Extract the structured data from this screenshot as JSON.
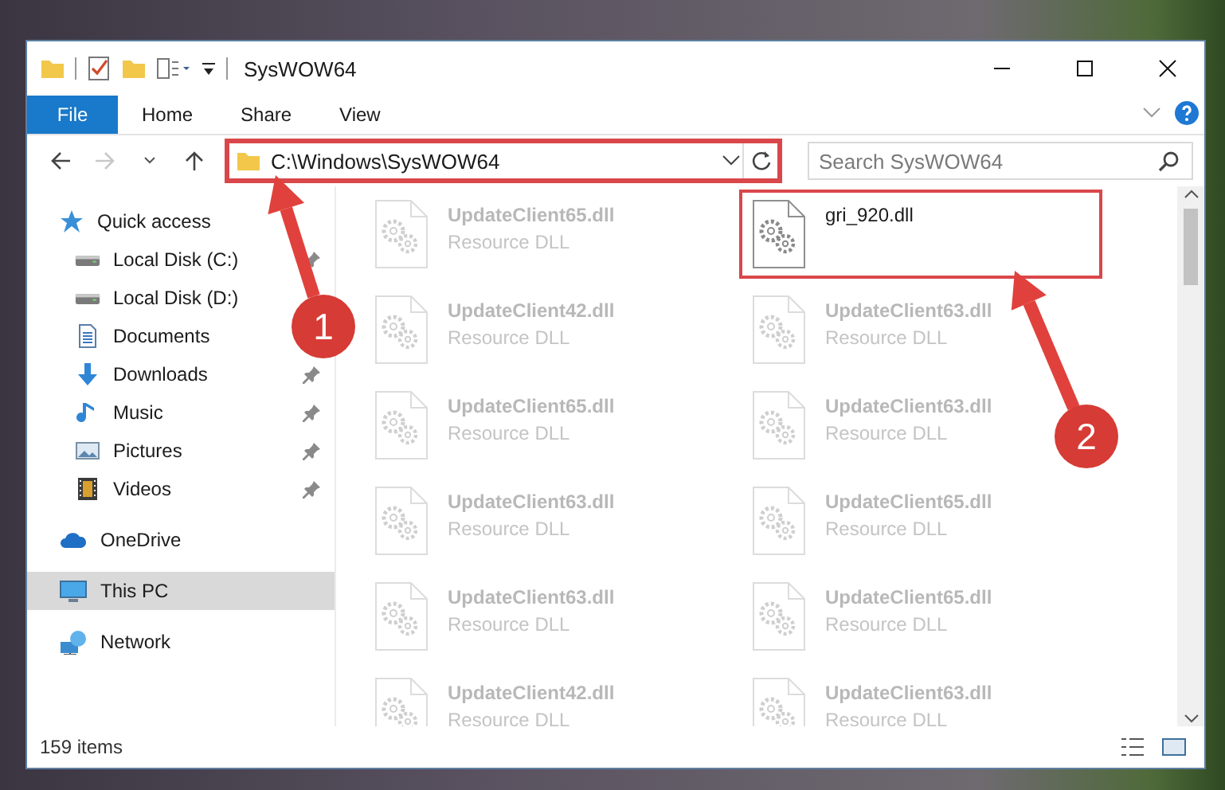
{
  "window": {
    "title": "SysWOW64"
  },
  "ribbon_tabs": [
    {
      "label": "File",
      "kind": "file",
      "selected": false
    },
    {
      "label": "Home",
      "kind": "tab",
      "selected": false
    },
    {
      "label": "Share",
      "kind": "tab",
      "selected": false
    },
    {
      "label": "View",
      "kind": "tab",
      "selected": false
    }
  ],
  "address_bar": {
    "path": "C:\\Windows\\SysWOW64",
    "highlighted": true
  },
  "search": {
    "placeholder": "Search SysWOW64"
  },
  "nav": [
    {
      "label": "Quick access",
      "kind": "star",
      "selected": false,
      "children": [
        {
          "label": "Local Disk (C:)",
          "kind": "drive",
          "pinned": true,
          "selected": false
        },
        {
          "label": "Local Disk (D:)",
          "kind": "drive",
          "pinned": false,
          "selected": false
        },
        {
          "label": "Documents",
          "kind": "documents",
          "pinned": false,
          "selected": false
        },
        {
          "label": "Downloads",
          "kind": "downloads",
          "pinned": true,
          "selected": false
        },
        {
          "label": "Music",
          "kind": "music",
          "pinned": true,
          "selected": false
        },
        {
          "label": "Pictures",
          "kind": "pictures",
          "pinned": true,
          "selected": false
        },
        {
          "label": "Videos",
          "kind": "videos",
          "pinned": true,
          "selected": false
        }
      ]
    },
    {
      "label": "OneDrive",
      "kind": "cloud",
      "selected": false
    },
    {
      "label": "This PC",
      "kind": "pc",
      "selected": true
    },
    {
      "label": "Network",
      "kind": "network",
      "selected": false
    }
  ],
  "files": [
    {
      "name": "UpdateClient65.dll",
      "type": "Resource DLL",
      "blurred": true,
      "highlighted": false
    },
    {
      "name": "gri_920.dll",
      "blurred": false,
      "highlighted": true
    },
    {
      "name": "UpdateClient42.dll",
      "type": "Resource DLL",
      "blurred": true,
      "highlighted": false
    },
    {
      "name": "UpdateClient63.dll",
      "type": "Resource DLL",
      "blurred": true,
      "highlighted": false
    },
    {
      "name": "UpdateClient65.dll",
      "type": "Resource DLL",
      "blurred": true,
      "highlighted": false
    },
    {
      "name": "UpdateClient63.dll",
      "type": "Resource DLL",
      "blurred": true,
      "highlighted": false
    },
    {
      "name": "UpdateClient63.dll",
      "type": "Resource DLL",
      "blurred": true,
      "highlighted": false
    },
    {
      "name": "UpdateClient65.dll",
      "type": "Resource DLL",
      "blurred": true,
      "highlighted": false
    },
    {
      "name": "UpdateClient63.dll",
      "type": "Resource DLL",
      "blurred": true,
      "highlighted": false
    },
    {
      "name": "UpdateClient65.dll",
      "type": "Resource DLL",
      "blurred": true,
      "highlighted": false
    },
    {
      "name": "UpdateClient42.dll",
      "type": "Resource DLL",
      "blurred": true,
      "highlighted": false
    },
    {
      "name": "UpdateClient63.dll",
      "type": "Resource DLL",
      "blurred": true,
      "highlighted": false
    }
  ],
  "annotations": [
    {
      "number": "1"
    },
    {
      "number": "2"
    }
  ],
  "status_bar": {
    "item_count": "159 items"
  }
}
